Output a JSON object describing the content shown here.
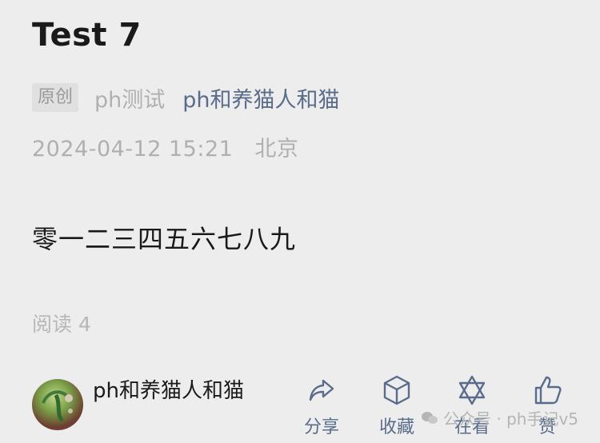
{
  "article": {
    "title": "Test 7",
    "badge": "原创",
    "author": "ph测试",
    "account": "ph和养猫人和猫",
    "datetime": "2024-04-12 15:21",
    "location": "北京",
    "content": "零一二三四五六七八九",
    "reads": "阅读 4"
  },
  "footer": {
    "account_name": "ph和养猫人和猫",
    "actions": [
      {
        "label": "分享",
        "icon": "share-icon"
      },
      {
        "label": "收藏",
        "icon": "cube-icon"
      },
      {
        "label": "在看",
        "icon": "star-of-david-icon"
      },
      {
        "label": "赞",
        "icon": "thumbs-up-icon"
      }
    ]
  },
  "watermark": "公众号 · ph手记v5",
  "colors": {
    "background": "#ededed",
    "link": "#5a6c8c",
    "muted": "#b0b0b0",
    "text": "#1a1a1a"
  }
}
